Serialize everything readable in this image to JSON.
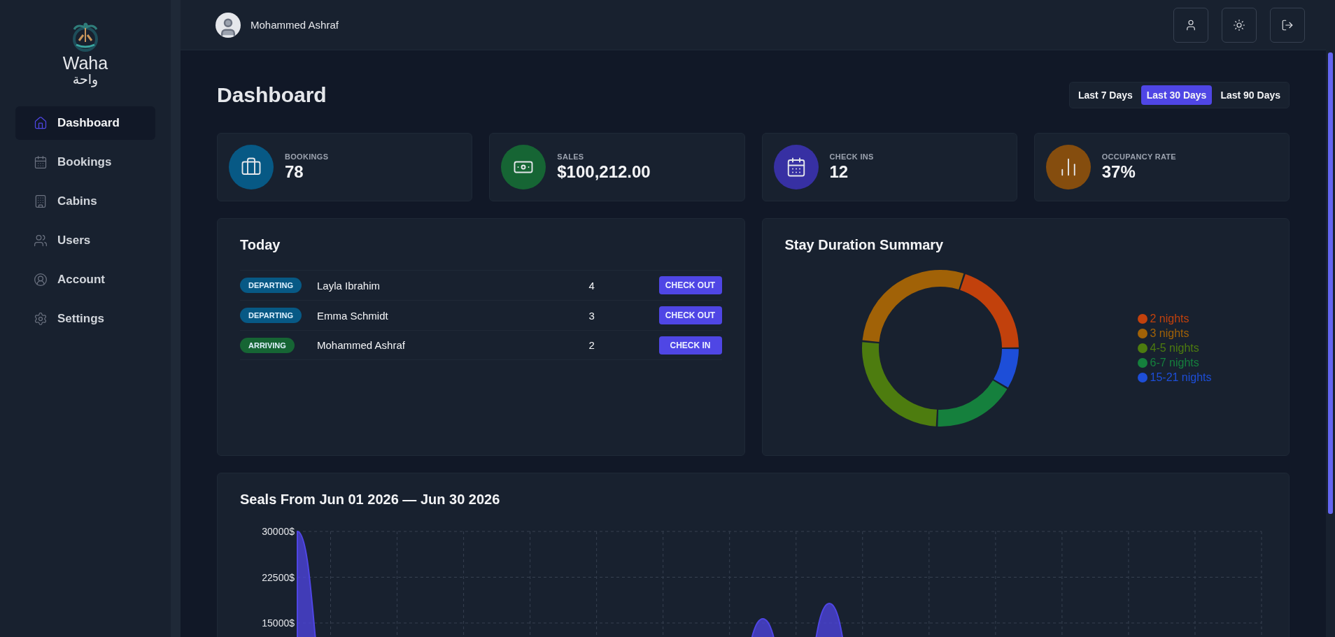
{
  "sidebar": {
    "logo": {
      "latin": "Waha",
      "arabic": "واحة"
    },
    "items": [
      {
        "label": "Dashboard",
        "selected": true
      },
      {
        "label": "Bookings",
        "selected": false
      },
      {
        "label": "Cabins",
        "selected": false
      },
      {
        "label": "Users",
        "selected": false
      },
      {
        "label": "Account",
        "selected": false
      },
      {
        "label": "Settings",
        "selected": false
      }
    ]
  },
  "header": {
    "user_name": "Mohammed Ashraf"
  },
  "page_title": "Dashboard",
  "filter": [
    {
      "label": "Last 7 Days",
      "selected": false
    },
    {
      "label": "Last 30 Days",
      "selected": true
    },
    {
      "label": "Last 90 Days",
      "selected": false
    }
  ],
  "stats": [
    {
      "label": "BOOKINGS",
      "value": "78",
      "color": "#075985"
    },
    {
      "label": "SALES",
      "value": "$100,212.00",
      "color": "#166534"
    },
    {
      "label": "CHECK INS",
      "value": "12",
      "color": "#3730a3"
    },
    {
      "label": "OCCUPANCY RATE",
      "value": "37%",
      "color": "#854d0e"
    }
  ],
  "today": {
    "title": "Today",
    "rows": [
      {
        "status": "DEPARTING",
        "kind": "departing",
        "guest": "Layla Ibrahim",
        "nights": "4",
        "action": "CHECK OUT"
      },
      {
        "status": "DEPARTING",
        "kind": "departing",
        "guest": "Emma Schmidt",
        "nights": "3",
        "action": "CHECK OUT"
      },
      {
        "status": "ARRIVING",
        "kind": "arriving",
        "guest": "Mohammed Ashraf",
        "nights": "2",
        "action": "CHECK IN"
      }
    ]
  },
  "stay_summary": {
    "title": "Stay Duration Summary",
    "chart_data": {
      "type": "donut",
      "categories": [
        "2 nights",
        "3 nights",
        "4-5 nights",
        "6-7 nights",
        "15-21 nights"
      ],
      "values": [
        7,
        10,
        9,
        6,
        3
      ],
      "colors": [
        "#c2410c",
        "#a16207",
        "#4d7c0f",
        "#15803d",
        "#1d4ed8"
      ]
    }
  },
  "sales": {
    "title": "Seals From Jun 01 2026 — Jun 30 2026",
    "chart_data": {
      "type": "area",
      "grid": true,
      "series": [
        {
          "color": "#4f46e5",
          "values": [
            30000,
            0,
            0,
            0,
            0,
            0,
            0,
            0,
            0,
            0,
            0,
            0,
            0,
            0,
            15700,
            0,
            18200,
            0,
            0,
            0,
            0,
            0,
            0,
            0,
            0,
            0,
            0,
            0,
            0,
            0
          ]
        }
      ],
      "ylim": [
        0,
        30000
      ],
      "yticks": [
        {
          "value": 15000,
          "label": "15000$"
        },
        {
          "value": 22500,
          "label": "22500$"
        },
        {
          "value": 30000,
          "label": "30000$"
        }
      ]
    }
  }
}
